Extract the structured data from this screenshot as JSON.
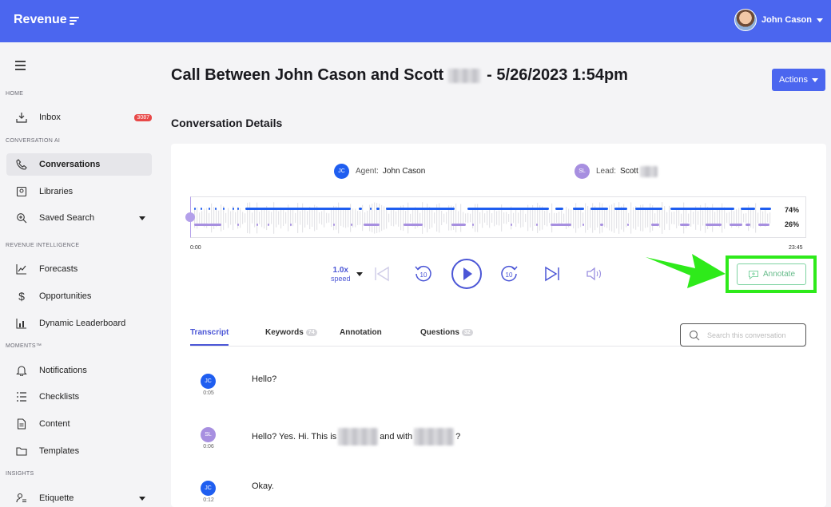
{
  "app": {
    "logo": "Revenue"
  },
  "user": {
    "name": "John Cason"
  },
  "sidebar": {
    "sections": {
      "home": "HOME",
      "conversation_ai": "CONVERSATION AI",
      "revenue_intelligence": "REVENUE INTELLIGENCE",
      "moments": "MOMENTS™",
      "insights": "INSIGHTS"
    },
    "items": [
      {
        "label": "Inbox",
        "badge": "3087"
      },
      {
        "label": "Conversations"
      },
      {
        "label": "Libraries"
      },
      {
        "label": "Saved Search"
      },
      {
        "label": "Forecasts"
      },
      {
        "label": "Opportunities"
      },
      {
        "label": "Dynamic Leaderboard"
      },
      {
        "label": "Notifications"
      },
      {
        "label": "Checklists"
      },
      {
        "label": "Content"
      },
      {
        "label": "Templates"
      },
      {
        "label": "Etiquette"
      }
    ]
  },
  "page": {
    "title_prefix": "Call Between John Cason and Scott",
    "title_suffix": "- 5/26/2023 1:54pm",
    "actions_label": "Actions",
    "subtitle": "Conversation Details"
  },
  "participants": {
    "agent": {
      "initials": "JC",
      "label": "Agent:",
      "name": "John Cason"
    },
    "lead": {
      "initials": "SL",
      "label": "Lead:",
      "name": "Scott"
    }
  },
  "player": {
    "agent_pct": "74%",
    "lead_pct": "26%",
    "start_time": "0:00",
    "end_time": "23:45",
    "speed_value": "1.0x",
    "speed_label": "speed",
    "annotate_label": "Annotate",
    "rewind_seconds": "10",
    "forward_seconds": "10"
  },
  "tabs": [
    {
      "label": "Transcript"
    },
    {
      "label": "Keywords",
      "count": "74"
    },
    {
      "label": "Annotation"
    },
    {
      "label": "Questions",
      "count": "32"
    }
  ],
  "search": {
    "placeholder": "Search this conversation"
  },
  "transcript": [
    {
      "initials": "JC",
      "time": "0:05",
      "text": "Hello?"
    },
    {
      "initials": "SL",
      "time": "0:06",
      "text_a": "Hello? Yes. Hi. This is",
      "text_b": "and with",
      "text_c": "?"
    },
    {
      "initials": "JC",
      "time": "0:12",
      "text": "Okay."
    }
  ],
  "colors": {
    "brand": "#4b66ef",
    "agent": "#1f5ef0",
    "lead": "#a78fe0",
    "highlight": "#2eea1a",
    "annotate": "#66bb8a"
  }
}
